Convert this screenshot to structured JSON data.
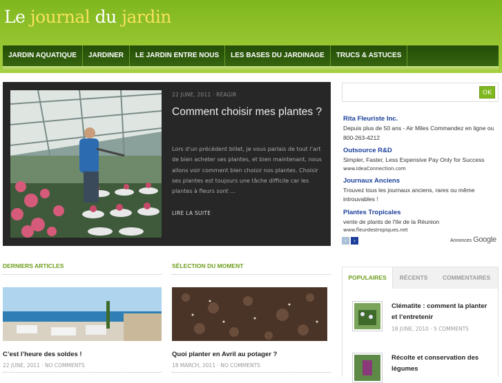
{
  "header": {
    "logo_part1": "Le",
    "logo_part2": "journal",
    "logo_part3": "du",
    "logo_part4": "jardin"
  },
  "nav": [
    "JARDIN AQUATIQUE",
    "JARDINER",
    "LE JARDIN ENTRE NOUS",
    "LES BASES DU JARDINAGE",
    "TRUCS & ASTUCES"
  ],
  "featured": {
    "meta": "22 JUNE, 2011 · RÉAGIR",
    "title": "Comment choisir mes plantes ?",
    "excerpt": "Lors d’un précédent billet, je vous parlais de tout l’art de bien acheter ses plantes, et bien maintenant, nous allons voir comment bien choisir nos plantes. Choisir ses plantes est toujours une tâche difficile car les plantes à fleurs sont ...",
    "read_more": "LIRE LA SUITE"
  },
  "search": {
    "button": "OK",
    "placeholder": ""
  },
  "ads": [
    {
      "title": "Rita Fleuriste Inc.",
      "desc": "Depuis plus de 50 ans - Air Miles Commandez en ligne ou 800-263-4212",
      "url": ""
    },
    {
      "title": "Outsource R&D",
      "desc": "Simpler, Faster, Less Expensive Pay Only for Success",
      "url": "www.IdeaConnection.com"
    },
    {
      "title": "Journaux Anciens",
      "desc": "Trouvez tous les journaux anciens, rares ou même introuvables !",
      "url": ""
    },
    {
      "title": "Plantes Tropicales",
      "desc": "vente de plants de l'Ile de la Réunion",
      "url": "www.fleurdestropiques.net"
    }
  ],
  "ads_footer": {
    "label": "Annonces",
    "brand": "Google"
  },
  "sections": {
    "latest": "DERNIERS ARTICLES",
    "selection": "SÉLECTION DU MOMENT"
  },
  "latest_post": {
    "title": "C’est l’heure des soldes !",
    "meta": "22 JUNE, 2011 · NO COMMENTS"
  },
  "selection_post": {
    "title": "Quoi planter en Avril au potager ?",
    "meta": "18 MARCH, 2011 · NO COMMENTS"
  },
  "tabs": [
    "POPULAIRES",
    "RÉCENTS",
    "COMMENTAIRES"
  ],
  "popular": [
    {
      "title": "Clématite : comment la planter et l’entretenir",
      "meta": "18 JUNE, 2010 · 5 COMMENTS"
    },
    {
      "title": "Récolte et conservation des légumes",
      "meta": ""
    }
  ],
  "colors": {
    "brand_green": "#7fb71e",
    "nav_dark": "#2a560a",
    "section_green": "#6d9e1c",
    "ad_link": "#1a3e9a"
  }
}
